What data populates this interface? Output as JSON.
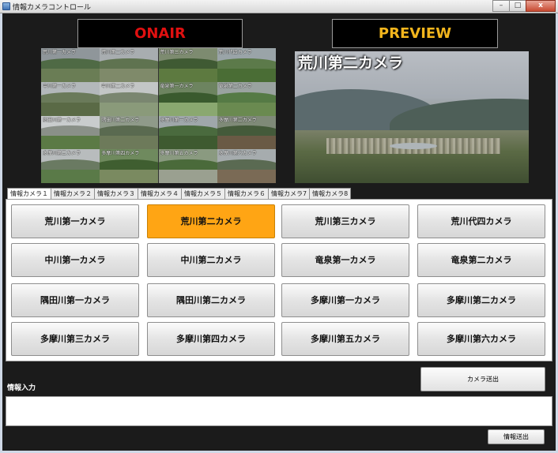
{
  "window": {
    "title": "情報カメラコントロール",
    "minimize": "–",
    "maximize": "□",
    "close": "x"
  },
  "onair_label": "ONAIR",
  "preview_label": "PREVIEW",
  "mosaic": [
    "荒川第一カメラ",
    "荒川第二カメラ",
    "荒川第三カメラ",
    "荒川代四カメラ",
    "中川第一カメラ",
    "中川第二カメラ",
    "竜泉第一カメラ",
    "竜泉第二カメラ",
    "隅田川第一カメラ",
    "隅田川第二カメラ",
    "多摩川第一カメラ",
    "多摩川第二カメラ",
    "多摩川第三カメラ",
    "多摩川第四カメラ",
    "多摩川第五カメラ",
    "多摩川第六カメラ"
  ],
  "preview_title": "荒川第二カメラ",
  "tabs": [
    "情報カメラ１",
    "情報カメラ２",
    "情報カメラ３",
    "情報カメラ４",
    "情報カメラ５",
    "情報カメラ６",
    "情報カメラ7",
    "情報カメラ8"
  ],
  "active_tab": 0,
  "cameras": [
    "荒川第一カメラ",
    "荒川第二カメラ",
    "荒川第三カメラ",
    "荒川代四カメラ",
    "中川第一カメラ",
    "中川第二カメラ",
    "竜泉第一カメラ",
    "竜泉第二カメラ",
    "隅田川第一カメラ",
    "隅田川第二カメラ",
    "多摩川第一カメラ",
    "多摩川第二カメラ",
    "多摩川第三カメラ",
    "多摩川第四カメラ",
    "多摩川第五カメラ",
    "多摩川第六カメラ"
  ],
  "selected_camera": 1,
  "send_camera_label": "カメラ送出",
  "info_label": "情報入力",
  "info_value": "",
  "send_info_label": "情報送出",
  "colors": {
    "selected": "#ffa514",
    "onair": "#e01010",
    "preview": "#f2b51d",
    "background": "#1b1b1b"
  }
}
